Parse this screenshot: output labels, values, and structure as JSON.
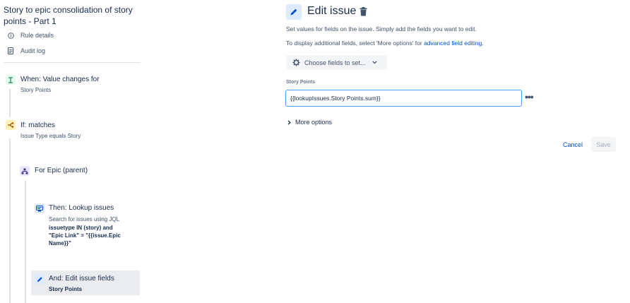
{
  "sidebar": {
    "title": "Story to epic consolidation of story points - Part 1",
    "links": [
      {
        "label": "Rule details",
        "icon": "info-icon"
      },
      {
        "label": "Audit log",
        "icon": "document-icon"
      }
    ],
    "steps": {
      "trigger": {
        "title": "When: Value changes for",
        "subtitle": "Story Points",
        "icon": "field-value-icon",
        "color": "#e3fcef"
      },
      "condition": {
        "title": "If: matches",
        "subtitle": "Issue Type equals Story",
        "icon": "branch-icon",
        "color": "#fff0b3"
      },
      "branch": {
        "title": "For Epic (parent)",
        "icon": "hierarchy-icon",
        "color": "#eae6ff"
      },
      "lookup": {
        "title": "Then: Lookup issues",
        "subtitle": "Search for issues using JQL",
        "jql_line1": "issuetype IN (story) and",
        "jql_line2": "\"Epic Link\" = \"{{issue.Epic",
        "jql_line3": "Name}}\"",
        "icon": "search-issues-icon",
        "color": "#deebff"
      },
      "edit": {
        "title": "And: Edit issue fields",
        "subtitle": "Story Points",
        "icon": "pencil-icon",
        "color": "#deebff"
      }
    }
  },
  "panel": {
    "title": "Edit issue",
    "description_1": "Set values for fields on the issue. Simply add the fields you want to edit.",
    "description_2_prefix": "To display additional fields, select 'More options' for ",
    "description_2_link": "advanced field editing",
    "description_2_suffix": ".",
    "choose_fields_label": "Choose fields to set...",
    "field_label": "Story Points",
    "field_value": "{{lookupIssues.Story Points.sum}}",
    "more_options_label": "More options",
    "cancel_label": "Cancel",
    "save_label": "Save",
    "accent_color": "#0052cc"
  }
}
